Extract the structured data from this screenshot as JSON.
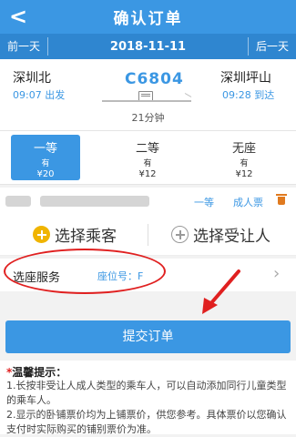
{
  "header": {
    "back_glyph": "<",
    "title": "确认订单"
  },
  "datebar": {
    "prev": "前一天",
    "date": "2018-11-11",
    "next": "后一天"
  },
  "train": {
    "from_station": "深圳北",
    "from_time": "09:07 出发",
    "train_no": "C6804",
    "to_station": "深圳坪山",
    "to_time": "09:28 到达",
    "duration": "21分钟"
  },
  "seats": [
    {
      "name": "一等",
      "avail": "有",
      "price": "¥20",
      "selected": true
    },
    {
      "name": "二等",
      "avail": "有",
      "price": "¥12",
      "selected": false
    },
    {
      "name": "无座",
      "avail": "有",
      "price": "¥12",
      "selected": false
    }
  ],
  "passenger": {
    "seat_class": "一等",
    "ticket_type": "成人票"
  },
  "choosers": {
    "select_passenger": "选择乘客",
    "select_beneficiary": "选择受让人"
  },
  "seat_service": {
    "label": "选座服务",
    "value": "座位号：F"
  },
  "submit_label": "提交订单",
  "tips": {
    "title": "温馨提示：",
    "star": "*",
    "lines": [
      "1.长按非受让人成人类型的乘车人，可以自动添加同行儿童类型的乘车人。",
      "2.显示的卧铺票价均为上铺票价，供您参考。具体票价以您确认支付时实际购买的铺别票价为准。"
    ]
  },
  "colors": {
    "primary": "#3b97e3",
    "annotation": "#e02020",
    "accent": "#f0b400"
  }
}
